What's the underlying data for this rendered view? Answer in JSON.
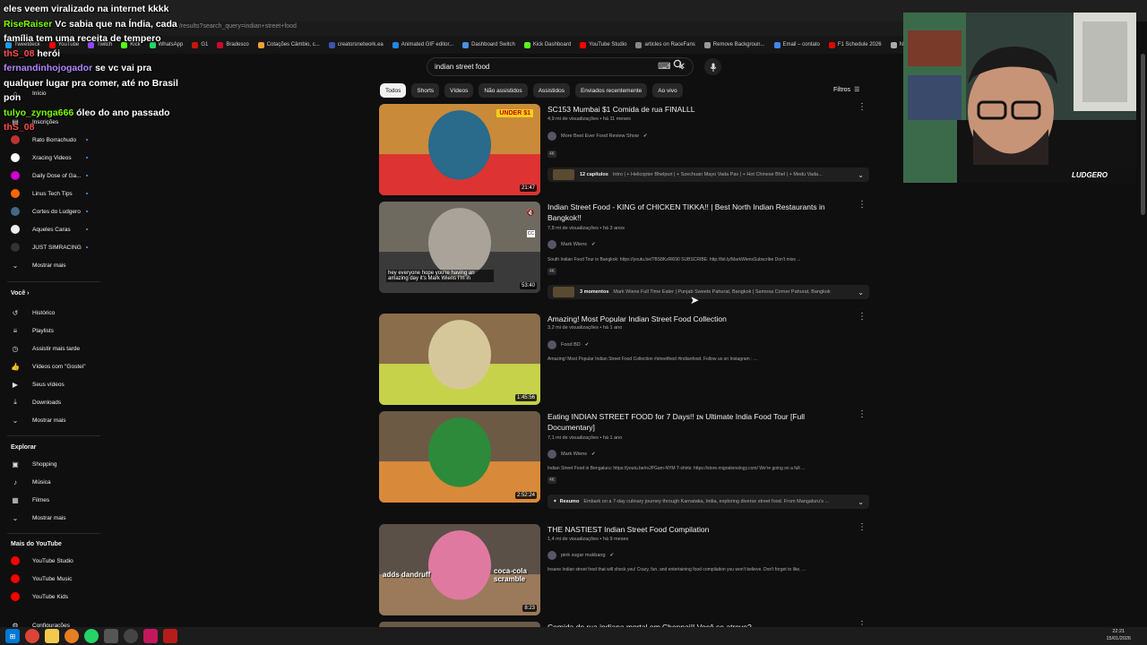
{
  "browser": {
    "url": "/results?search_query=indian+street+food",
    "bookmarks": [
      {
        "label": "Tweetdeck",
        "color": "#1d9bf0"
      },
      {
        "label": "YouTube",
        "color": "#ff0000"
      },
      {
        "label": "Twitch",
        "color": "#9146ff"
      },
      {
        "label": "Kick",
        "color": "#53fc18"
      },
      {
        "label": "WhatsApp",
        "color": "#25d366"
      },
      {
        "label": "G1",
        "color": "#c4170c"
      },
      {
        "label": "Bradesco",
        "color": "#cc092f"
      },
      {
        "label": "Cotações Câmbio, c...",
        "color": "#f0a030"
      },
      {
        "label": "creatorsnetwork.ea",
        "color": "#3f51b5"
      },
      {
        "label": "Animated GIF editor...",
        "color": "#1e88e5"
      },
      {
        "label": "Dashboard Switch",
        "color": "#4a90e2"
      },
      {
        "label": "Kick Dashboard",
        "color": "#53fc18"
      },
      {
        "label": "YouTube Studio",
        "color": "#ff0000"
      },
      {
        "label": "articles on RaceFans",
        "color": "#888888"
      },
      {
        "label": "Remove Backgroun...",
        "color": "#999999"
      },
      {
        "label": "Email – contato",
        "color": "#4285f4"
      },
      {
        "label": "F1 Schedule 2026",
        "color": "#e10600"
      },
      {
        "label": "NFS",
        "color": "#aaaaaa"
      }
    ]
  },
  "search": {
    "query": "indian street food"
  },
  "chips": [
    "Todos",
    "Shorts",
    "Vídeos",
    "Não assistidos",
    "Assistidos",
    "Enviados recentemente",
    "Ao vivo"
  ],
  "filters_label": "Filtros",
  "sidebar": {
    "top_items": [
      {
        "label": "Início",
        "icon": "home-icon"
      },
      {
        "label": "Inscrições",
        "icon": "subscriptions-icon"
      }
    ],
    "subscriptions": [
      {
        "label": "Rato Borrachudo",
        "color": "#b33"
      },
      {
        "label": "Xracing Videos",
        "color": "#fff"
      },
      {
        "label": "Daily Dose of Ga...",
        "color": "#c0c"
      },
      {
        "label": "Linus Tech Tips",
        "color": "#f60"
      },
      {
        "label": "Cortes do Ludgero",
        "color": "#468"
      },
      {
        "label": "Aqueles Caras",
        "color": "#eee"
      },
      {
        "label": "JUST SIMRACING",
        "color": "#333"
      }
    ],
    "more_label": "Mostrar mais",
    "you_header": "Você",
    "you_items": [
      {
        "label": "Histórico",
        "icon": "history-icon"
      },
      {
        "label": "Playlists",
        "icon": "playlist-icon"
      },
      {
        "label": "Assistir mais tarde",
        "icon": "clock-icon"
      },
      {
        "label": "Vídeos com \"Gostei\"",
        "icon": "thumbs-up-icon"
      },
      {
        "label": "Seus vídeos",
        "icon": "video-icon"
      },
      {
        "label": "Downloads",
        "icon": "download-icon"
      }
    ],
    "explore_header": "Explorar",
    "explore_items": [
      {
        "label": "Shopping",
        "icon": "bag-icon"
      },
      {
        "label": "Música",
        "icon": "music-icon"
      },
      {
        "label": "Filmes",
        "icon": "film-icon"
      }
    ],
    "more_header": "Mais do YouTube",
    "more_items": [
      {
        "label": "YouTube Studio"
      },
      {
        "label": "YouTube Music"
      },
      {
        "label": "YouTube Kids"
      }
    ],
    "settings_label": "Configurações"
  },
  "videos": [
    {
      "title": "SC153 Mumbai $1 Comida de rua FINALLL",
      "meta": "4,9 mi de visualizações • há 11 meses",
      "channel": "More Best Ever Food Review Show",
      "badge": "4K",
      "duration": "21:47",
      "thumb_colors": [
        "#c98a3a",
        "#2a6a8a",
        "#d33"
      ],
      "chapters_count": "12 capítulos",
      "chapters": "Intro | + Helicopter Bhelpuri | + Szechuan Mayo Vada Pav | + Hot Chinese Bhel | + Medu Vada..."
    },
    {
      "title": "Indian Street Food - KING of CHICKEN TIKKA!! | Best North Indian Restaurants in Bangkok!!",
      "meta": "7,8 mi de visualizações • há 3 anos",
      "channel": "Mark Wiens",
      "desc": "South Indian Food Tour in Bangkok: https://youtu.be/TBS8KzRl690 SUBSCRIBE: http://bit.ly/MarkWiensSubscribe Don't miss ...",
      "badge": "4K",
      "duration": "53:40",
      "caption": "hey everyone hope you're having an amazing day it's Mark Wiens I'm in",
      "thumb_colors": [
        "#6f6a60",
        "#a9a39a",
        "#3a3a3a"
      ],
      "chapters_count": "3 momentos",
      "chapters": "Mark Wiens Full Time Eater | Punjab Sweets Pahurat, Bangkok | Samosa Corner Pahurat, Bangkok"
    },
    {
      "title": "Amazing! Most Popular Indian Street Food Collection",
      "meta": "3,2 mi de visualizações • há 1 ano",
      "channel": "Food BD",
      "desc": "Amazing! Most Popular Indian Street Food Collection #streetfood #indianfood. Follow us on Instagram : ...",
      "duration": "1:45:56",
      "thumb_colors": [
        "#8a6d4a",
        "#d6c79b",
        "#c6d24a"
      ]
    },
    {
      "title": "Eating INDIAN STREET FOOD for 7 Days!! ɪɴ Ultimate India Food Tour [Full Documentary]",
      "meta": "7,1 mi de visualizações • há 1 ano",
      "channel": "Mark Wiens",
      "desc": "Indian Street Food in Bengaluru: https://youtu.be/rvJPGam-NYM T-shirts: https://store.migrationology.com/ We're going on a full ...",
      "badge": "4K",
      "duration": "2:52:24",
      "thumb_colors": [
        "#6c5a45",
        "#2c8a3a",
        "#d88a3a"
      ],
      "summary_label": "Resumo",
      "summary": "Embark on a 7-day culinary journey through Karnataka, India, exploring diverse street food. From Mangaluru's ..."
    },
    {
      "title": "THE NASTIEST Indian Street Food Compilation",
      "meta": "1,4 mi de visualizações • há 9 meses",
      "channel": "pink sugar mukbang",
      "desc": "Insane Indian street food that will shock you! Crazy, fun, and entertaining food compilation you won't believe. Don't forget to like, ...",
      "duration": "8:23",
      "caption1": "adds dandruff",
      "caption2": "coca-cola scramble",
      "thumb_colors": [
        "#5a5048",
        "#e079a0",
        "#9a7a5a"
      ]
    },
    {
      "title": "Comida de rua indiana mortal em Chennai!! Você se atreve?"
    }
  ],
  "chat": [
    {
      "user": "",
      "text": "eles veem viralizado na internet kkkk",
      "color": "#ffffff"
    },
    {
      "user": "RiseRaiser",
      "text": "Vc sabia que na Índia, cada família tem uma receita de tempero",
      "color": "#7cfc00"
    },
    {
      "user": "thS_08",
      "text": "herói",
      "color": "#ff4d4d"
    },
    {
      "user": "fernandinhojogador",
      "text": "se vc vai pra qualquer lugar pra comer, até no Brasil pon",
      "color": "#b388ff"
    },
    {
      "user": "tulyo_zynga666",
      "text": "óleo do ano passado",
      "color": "#7cfc00"
    },
    {
      "user": "thS_08",
      "text": "",
      "color": "#ff4d4d"
    }
  ],
  "cam_logo": "LUDGERO",
  "clock": {
    "time": "22:21",
    "date": "15/01/2026"
  }
}
